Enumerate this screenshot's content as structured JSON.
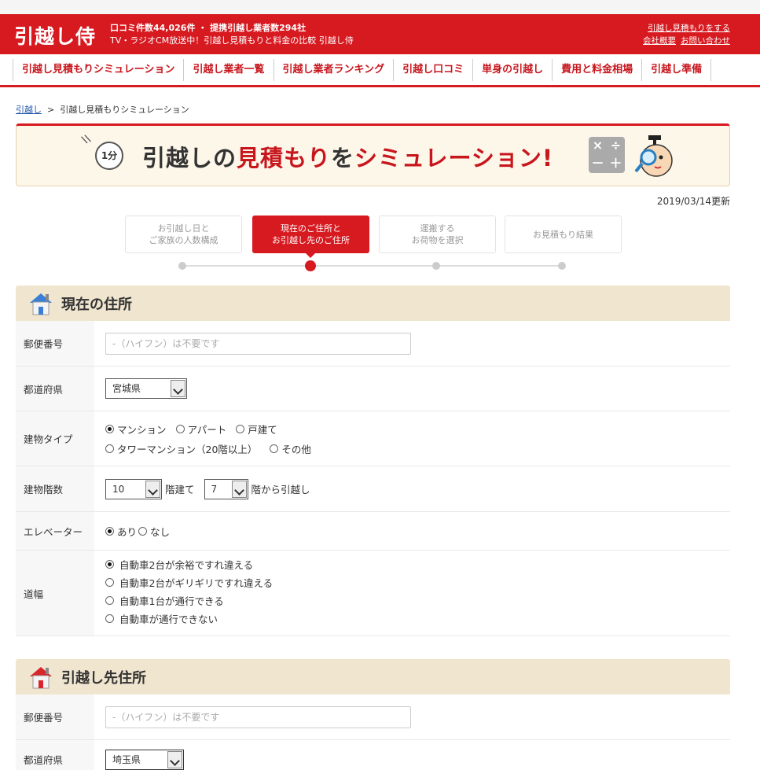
{
  "header": {
    "logo": "引越し侍",
    "info_line1": "口コミ件数44,026件 ・ 提携引越し業者数294社",
    "info_line2": "TV・ラジオCM放送中！引越し見積もりと料金の比較 引越し侍",
    "link_estimate": "引越し見積もりをする",
    "link_company": "会社概要",
    "link_contact": "お問い合わせ"
  },
  "nav": [
    "引越し見積もりシミュレーション",
    "引越し業者一覧",
    "引越し業者ランキング",
    "引越し口コミ",
    "単身の引越し",
    "費用と料金相場",
    "引越し準備"
  ],
  "breadcrumb": {
    "home": "引越し",
    "separator": ">",
    "current": "引越し見積もりシミュレーション"
  },
  "banner": {
    "badge": "1分",
    "title_part1": "引越しの",
    "title_part2": "見積もり",
    "title_part3": "を",
    "title_part4": "シミュレーション!",
    "calc_symbols": [
      "×",
      "÷",
      "－",
      "＋"
    ]
  },
  "updated": "2019/03/14更新",
  "steps": [
    {
      "line1": "お引越し日と",
      "line2": "ご家族の人数構成",
      "active": false
    },
    {
      "line1": "現在のご住所と",
      "line2": "お引越し先のご住所",
      "active": true
    },
    {
      "line1": "運搬する",
      "line2": "お荷物を選択",
      "active": false
    },
    {
      "line1": "お見積もり結果",
      "line2": "",
      "active": false
    }
  ],
  "current": {
    "title": "現在の住所",
    "postal_label": "郵便番号",
    "postal_placeholder": "-（ハイフン）は不要です",
    "pref_label": "都道府県",
    "pref_value": "宮城県",
    "building_label": "建物タイプ",
    "building_options": [
      "マンション",
      "アパート",
      "戸建て",
      "タワーマンション（20階以上）",
      "その他"
    ],
    "building_selected": "マンション",
    "floors_label": "建物階数",
    "floors_total": "10",
    "floors_total_suffix": "階建て",
    "floors_from": "7",
    "floors_from_suffix": "階から引越し",
    "elevator_label": "エレベーター",
    "elevator_yes": "あり",
    "elevator_no": "なし",
    "road_label": "道幅",
    "road_options": [
      "自動車2台が余裕ですれ違える",
      "自動車2台がギリギリですれ違える",
      "自動車1台が通行できる",
      "自動車が通行できない"
    ]
  },
  "destination": {
    "title": "引越し先住所",
    "postal_label": "郵便番号",
    "postal_placeholder": "-（ハイフン）は不要です",
    "pref_label": "都道府県",
    "pref_value": "埼玉県"
  },
  "colors": {
    "brand_red": "#d71920",
    "section_head": "#f0e5cf"
  }
}
